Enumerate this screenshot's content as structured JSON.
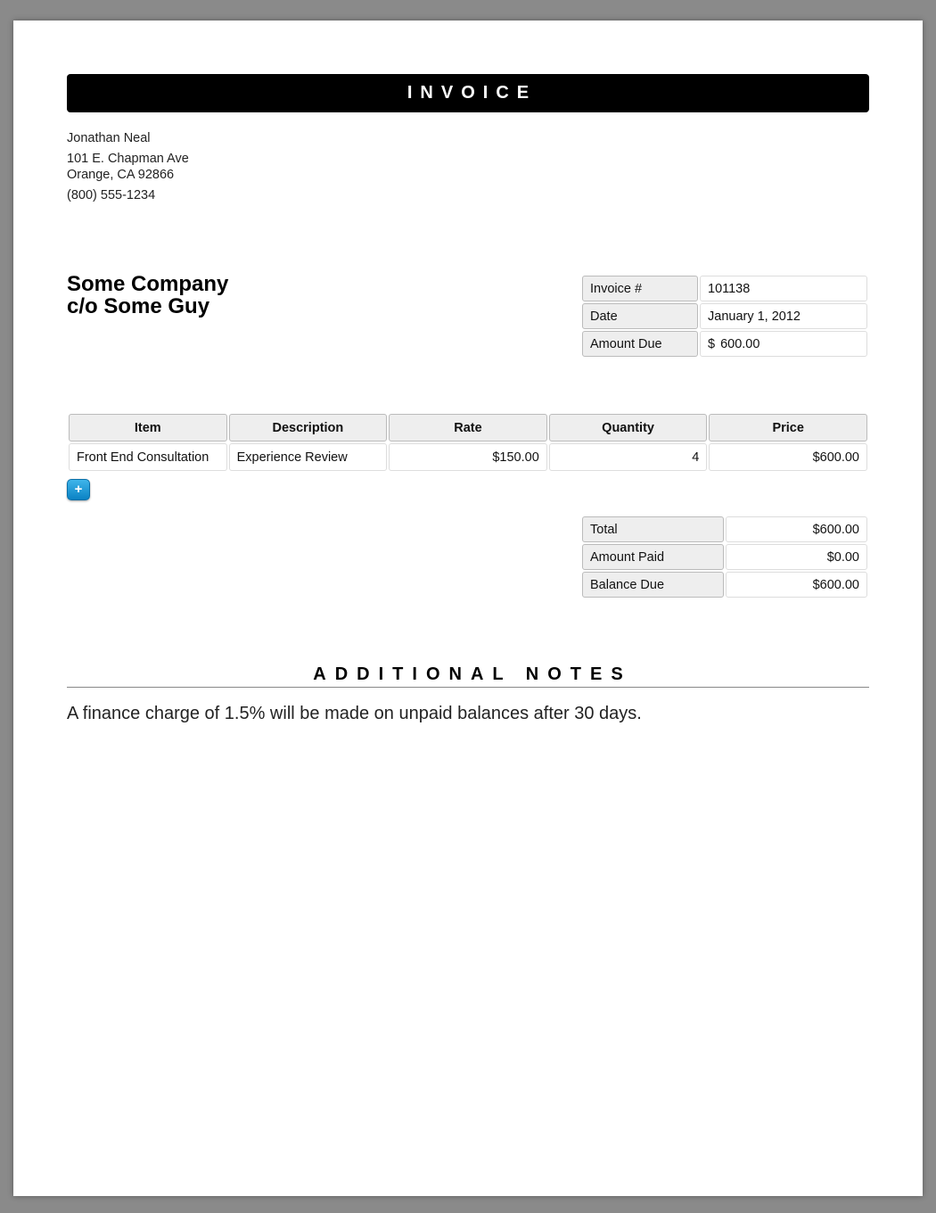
{
  "header": {
    "title": "INVOICE"
  },
  "sender": {
    "name": "Jonathan Neal",
    "street": "101 E. Chapman Ave",
    "city": "Orange, CA 92866",
    "phone": "(800) 555-1234"
  },
  "recipient": {
    "line1": "Some Company",
    "line2": "c/o Some Guy"
  },
  "meta": {
    "invoice_label": "Invoice #",
    "invoice_value": "101138",
    "date_label": "Date",
    "date_value": "January 1, 2012",
    "due_label": "Amount Due",
    "due_currency": "$",
    "due_value": "600.00"
  },
  "items": {
    "headers": [
      "Item",
      "Description",
      "Rate",
      "Quantity",
      "Price"
    ],
    "rows": [
      [
        "Front End Consultation",
        "Experience Review",
        "$150.00",
        "4",
        "$600.00"
      ]
    ],
    "add_label": "+"
  },
  "totals": {
    "total_label": "Total",
    "total_value": "$600.00",
    "paid_label": "Amount Paid",
    "paid_value": "$0.00",
    "balance_label": "Balance Due",
    "balance_value": "$600.00"
  },
  "notes": {
    "title": "ADDITIONAL NOTES",
    "text": "A finance charge of 1.5% will be made on unpaid balances after 30 days."
  },
  "colors": {
    "add_button": "#1a9ad6",
    "header_bg": "#000000"
  }
}
